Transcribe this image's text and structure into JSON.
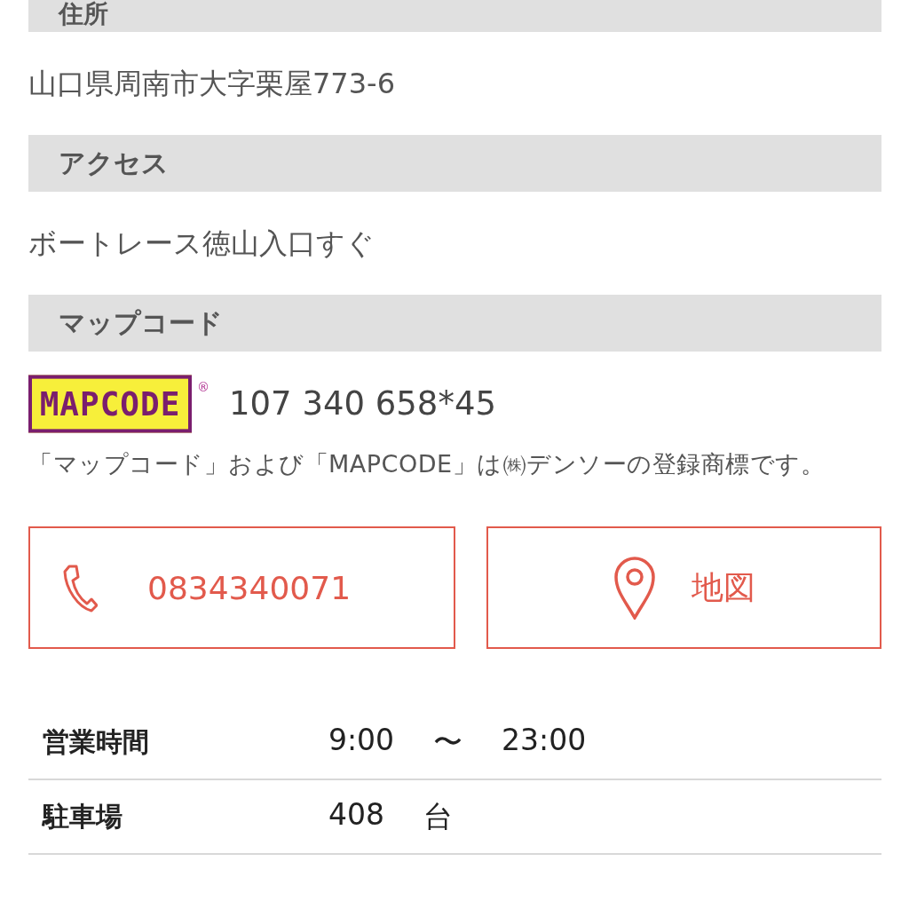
{
  "sections": [
    {
      "heading": "住所",
      "heading_cut": true,
      "body": "山口県周南市大字栗屋773-6"
    },
    {
      "heading": "アクセス",
      "heading_cut": false,
      "body": "ボートレース徳山入口すぐ"
    },
    {
      "heading": "マップコード",
      "heading_cut": false,
      "mapcode": {
        "logo": "MAPCODE",
        "registered": "®",
        "code": "107 340 658*45"
      },
      "note": "「マップコード」および「MAPCODE」は㈱デンソーの登録商標です。"
    }
  ],
  "buttons": [
    {
      "kind": "phone",
      "label": "0834340071"
    },
    {
      "kind": "map",
      "label": "地図"
    }
  ],
  "info_table": [
    {
      "label": "営業時間",
      "values": [
        "9:00",
        "〜",
        "23:00"
      ]
    },
    {
      "label": "駐車場",
      "values": [
        "408",
        "台"
      ]
    }
  ]
}
